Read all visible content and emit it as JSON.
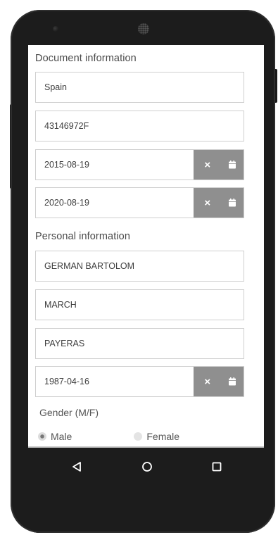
{
  "document_section": {
    "title": "Document information",
    "fields": {
      "country": "Spain",
      "document_number": "43146972F",
      "issue_date": "2015-08-19",
      "expiry_date": "2020-08-19"
    }
  },
  "personal_section": {
    "title": "Personal information",
    "fields": {
      "name": "GERMAN BARTOLOM",
      "first_surname": "MARCH",
      "second_surname": "PAYERAS",
      "birth_date": "1987-04-16"
    }
  },
  "gender": {
    "label": "Gender (M/F)",
    "options": [
      "Male",
      "Female"
    ],
    "selected": "Male"
  },
  "icons": {
    "clear": "clear-icon",
    "calendar": "calendar-icon",
    "nav_back": "back-triangle-icon",
    "nav_home": "home-circle-icon",
    "nav_recent": "recent-square-icon"
  },
  "colors": {
    "date_button_bg": "#8f8f8f",
    "device_frame": "#1c1c1c"
  }
}
